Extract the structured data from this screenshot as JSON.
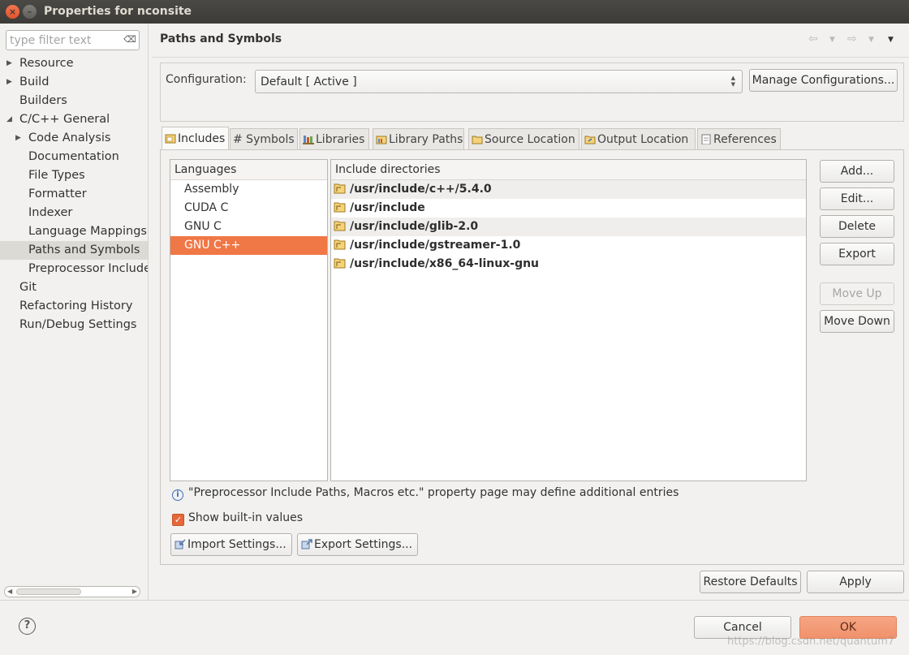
{
  "window": {
    "title": "Properties for nconsite"
  },
  "filter": {
    "placeholder": "type filter text"
  },
  "tree": [
    {
      "label": "Resource",
      "level": 0,
      "arrow": "▶"
    },
    {
      "label": "Build",
      "level": 0,
      "arrow": "▶"
    },
    {
      "label": "Builders",
      "level": 0,
      "arrow": ""
    },
    {
      "label": "C/C++ General",
      "level": 0,
      "arrow": "◢"
    },
    {
      "label": "Code Analysis",
      "level": 1,
      "arrow": "▶"
    },
    {
      "label": "Documentation",
      "level": 1,
      "arrow": ""
    },
    {
      "label": "File Types",
      "level": 1,
      "arrow": ""
    },
    {
      "label": "Formatter",
      "level": 1,
      "arrow": ""
    },
    {
      "label": "Indexer",
      "level": 1,
      "arrow": ""
    },
    {
      "label": "Language Mappings",
      "level": 1,
      "arrow": ""
    },
    {
      "label": "Paths and Symbols",
      "level": 1,
      "arrow": "",
      "selected": true
    },
    {
      "label": "Preprocessor Include",
      "level": 1,
      "arrow": ""
    },
    {
      "label": "Git",
      "level": 0,
      "arrow": ""
    },
    {
      "label": "Refactoring History",
      "level": 0,
      "arrow": ""
    },
    {
      "label": "Run/Debug Settings",
      "level": 0,
      "arrow": ""
    }
  ],
  "header": {
    "title": "Paths and Symbols"
  },
  "configuration": {
    "label": "Configuration:",
    "value": "Default  [ Active ]",
    "manage_button": "Manage Configurations..."
  },
  "tabs": [
    {
      "label": "Includes",
      "icon": "includes-icon",
      "active": true
    },
    {
      "label": "# Symbols",
      "icon": "",
      "active": false
    },
    {
      "label": "Libraries",
      "icon": "libraries-icon",
      "active": false
    },
    {
      "label": "Library Paths",
      "icon": "library-paths-icon",
      "active": false
    },
    {
      "label": "Source Location",
      "icon": "source-folder-icon",
      "active": false
    },
    {
      "label": "Output Location",
      "icon": "output-folder-icon",
      "active": false
    },
    {
      "label": "References",
      "icon": "references-icon",
      "active": false
    }
  ],
  "languages": {
    "header": "Languages",
    "items": [
      "Assembly",
      "CUDA C",
      "GNU C",
      "GNU C++"
    ],
    "selected_index": 3
  },
  "includes": {
    "header": "Include directories",
    "items": [
      "/usr/include/c++/5.4.0",
      "/usr/include",
      "/usr/include/glib-2.0",
      "/usr/include/gstreamer-1.0",
      "/usr/include/x86_64-linux-gnu"
    ]
  },
  "side_buttons": {
    "add": "Add...",
    "edit": "Edit...",
    "delete": "Delete",
    "export": "Export",
    "move_up": "Move Up",
    "move_down": "Move Down"
  },
  "info_text": "\"Preprocessor Include Paths, Macros etc.\" property page may define additional entries",
  "show_builtin": {
    "label": "Show built-in values",
    "checked": true
  },
  "import_settings": "Import Settings...",
  "export_settings": "Export Settings...",
  "restore_defaults": "Restore Defaults",
  "apply": "Apply",
  "cancel": "Cancel",
  "ok": "OK",
  "watermark": "https://blog.csdn.net/quantum7",
  "colors": {
    "accent": "#f07746",
    "titlebar": "#3c3b37",
    "ok_button": "#f0926c"
  }
}
